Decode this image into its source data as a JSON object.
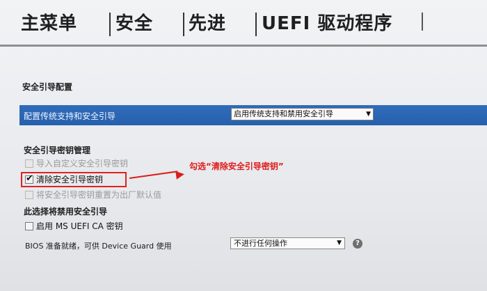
{
  "tabs": [
    {
      "label": "主菜单"
    },
    {
      "label": "安全"
    },
    {
      "label": "先进"
    },
    {
      "label": "UEFI 驱动程序"
    }
  ],
  "secure_boot": {
    "title": "安全引导配置",
    "legacy_label": "配置传统支持和安全引导",
    "legacy_value": "启用传统支持和禁用安全引导"
  },
  "key_mgmt": {
    "title": "安全引导密钥管理",
    "items": [
      {
        "label": "导入自定义安全引导密钥",
        "checked": false,
        "enabled": false
      },
      {
        "label": "清除安全引导密钥",
        "checked": true,
        "enabled": true
      },
      {
        "label": "将安全引导密钥重置为出厂默认值",
        "checked": false,
        "enabled": false
      }
    ]
  },
  "disable_section": {
    "title": "此选择将禁用安全引导",
    "item": {
      "label": "启用 MS UEFI CA 密钥",
      "checked": false
    }
  },
  "bios_guard": {
    "label": "BIOS 准备就绪，可供 Device Guard 使用",
    "value": "不进行任何操作"
  },
  "annotation": "勾选“清除安全引导密钥”",
  "icons": {
    "help": "help-icon",
    "check": "checkmark-icon",
    "dropdown": "chevron-down-icon"
  },
  "colors": {
    "highlight": "#2764b2",
    "annotation": "#e01b1b"
  }
}
